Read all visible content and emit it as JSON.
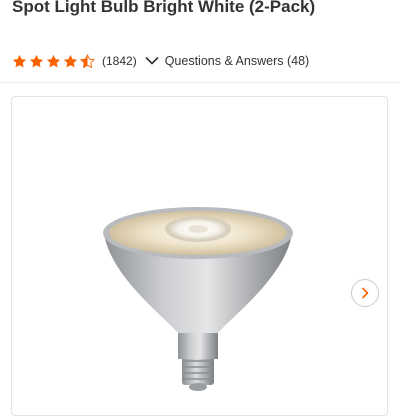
{
  "product": {
    "title": "Spot Light Bulb Bright White (2-Pack)"
  },
  "rating": {
    "stars": 4.5,
    "stars_max": 5,
    "review_count": "(1842)",
    "qa_label": "Questions & Answers (48)"
  },
  "icons": {
    "star": "star-icon",
    "chevron": "chevron-down-icon",
    "next": "chevron-right-icon"
  },
  "colors": {
    "star": "#f96302",
    "text": "#333333",
    "frame_border": "#e2e2e2"
  }
}
